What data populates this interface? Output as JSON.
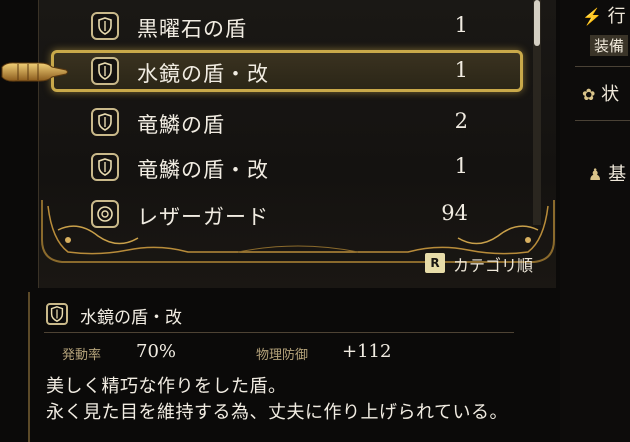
{
  "items": [
    {
      "name": "黒曜石の盾",
      "qty": "1",
      "icon": "shield-icon"
    },
    {
      "name": "水鏡の盾・改",
      "qty": "1",
      "icon": "shield-icon"
    },
    {
      "name": "竜鱗の盾",
      "qty": "2",
      "icon": "shield-icon"
    },
    {
      "name": "竜鱗の盾・改",
      "qty": "1",
      "icon": "shield-icon"
    },
    {
      "name": "レザーガード",
      "qty": "94",
      "icon": "round-shield-icon"
    }
  ],
  "selected_index": 1,
  "sort": {
    "key": "R",
    "label": "カテゴリ順"
  },
  "side_menu": [
    "行",
    "装備",
    "状",
    "基"
  ],
  "detail": {
    "title": "水鏡の盾・改",
    "stats": [
      {
        "label": "発動率",
        "value": "70%"
      },
      {
        "label": "物理防御",
        "value": "+112"
      }
    ],
    "description": [
      "美しく精巧な作りをした盾。",
      "永く見た目を維持する為、丈夫に作り上げられている。"
    ]
  },
  "colors": {
    "accent": "#c9a94a",
    "text": "#f1ece2",
    "label": "#b5a37a"
  }
}
